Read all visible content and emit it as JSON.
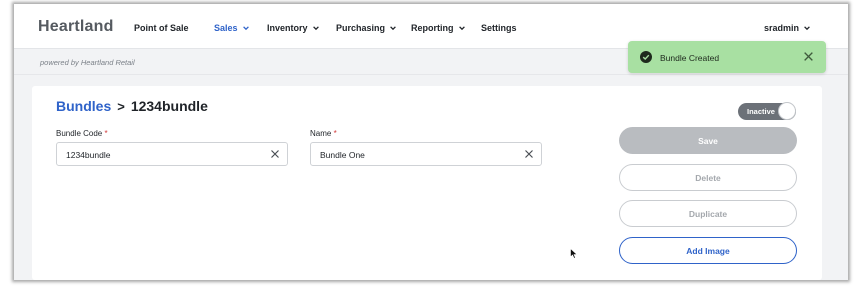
{
  "app": {
    "logo": "Heartland",
    "user": "sradmin"
  },
  "nav": {
    "point_of_sale": "Point of Sale",
    "sales": "Sales",
    "inventory": "Inventory",
    "purchasing": "Purchasing",
    "reporting": "Reporting",
    "settings": "Settings"
  },
  "subheader": {
    "powered_by": "powered by Heartland Retail"
  },
  "toast": {
    "message": "Bundle Created"
  },
  "breadcrumb": {
    "parent": "Bundles",
    "separator": ">",
    "current": "1234bundle"
  },
  "form": {
    "code_label": "Bundle Code",
    "code_value": "1234bundle",
    "name_label": "Name",
    "name_value": "Bundle One",
    "required_mark": "*"
  },
  "status": {
    "label": "Inactive"
  },
  "actions": {
    "save": "Save",
    "delete": "Delete",
    "duplicate": "Duplicate",
    "add_image": "Add Image"
  },
  "colors": {
    "accent": "#2f63c9",
    "toast_bg": "#a8e0a2",
    "toggle_bg": "#6c7178",
    "disabled_btn": "#b9bcc0"
  }
}
